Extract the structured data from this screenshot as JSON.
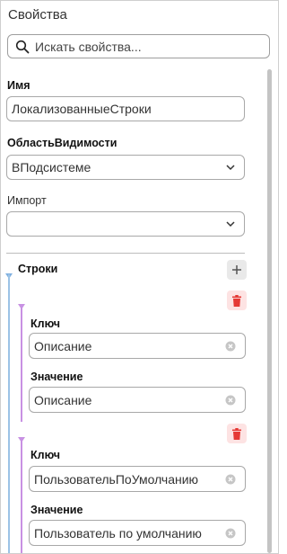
{
  "panel": {
    "title": "Свойства"
  },
  "search": {
    "placeholder": "Искать свойства..."
  },
  "fields": {
    "name": {
      "label": "Имя",
      "value": "ЛокализованныеСтроки"
    },
    "scope": {
      "label": "ОбластьВидимости",
      "value": "ВПодсистеме"
    },
    "import": {
      "label": "Импорт",
      "value": ""
    }
  },
  "strings_section": {
    "label": "Строки",
    "items": [
      {
        "key_label": "Ключ",
        "key_value": "Описание",
        "value_label": "Значение",
        "value_value": "Описание"
      },
      {
        "key_label": "Ключ",
        "key_value": "ПользовательПоУмолчанию",
        "value_label": "Значение",
        "value_value": "Пользователь по умолчанию"
      }
    ]
  },
  "colors": {
    "tree_line_blue": "#9cc3e6",
    "tree_line_purple": "#c891e3",
    "delete_red": "#e53935"
  }
}
